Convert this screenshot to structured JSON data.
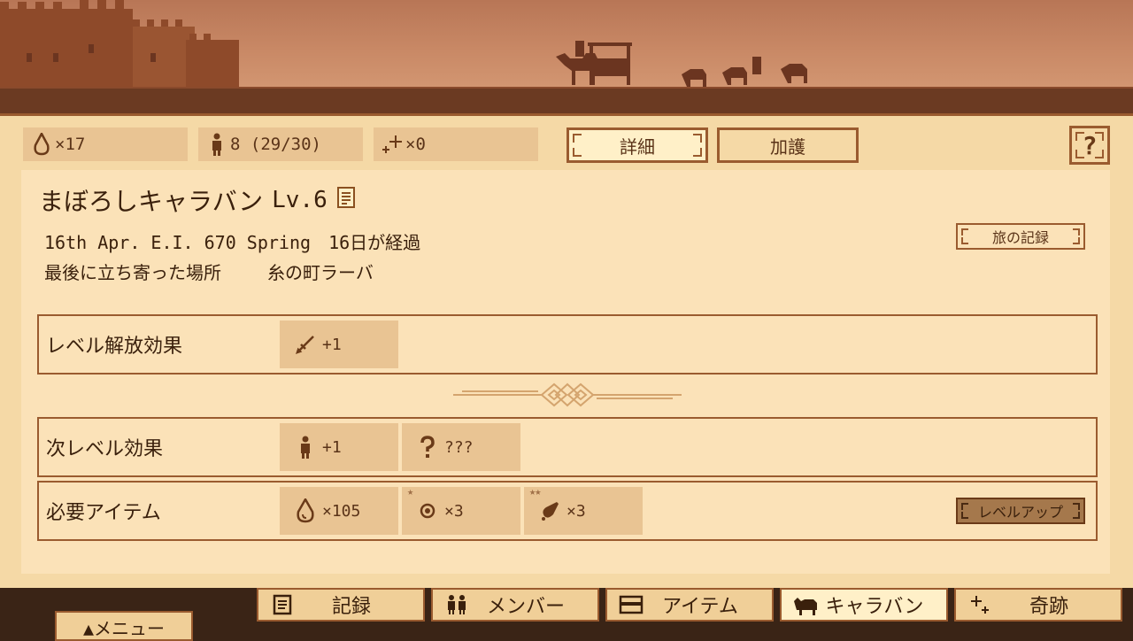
{
  "stats": {
    "water": "×17",
    "members": "8 (29/30)",
    "miracle": "×0"
  },
  "tabs": {
    "detail": "詳細",
    "blessing": "加護"
  },
  "help_label": "?",
  "caravan": {
    "name": "まぼろしキャラバン",
    "level": "Lv.6",
    "date": "16th Apr. E.I. 670 Spring",
    "elapsed": "16日が経過",
    "last_place_label": "最後に立ち寄った場所",
    "last_place": "糸の町ラーバ",
    "travel_log_button": "旅の記録"
  },
  "rows": {
    "level_effect": {
      "label": "レベル解放効果",
      "items": [
        {
          "icon": "sword-icon",
          "text": "+1"
        }
      ]
    },
    "next_effect": {
      "label": "次レベル効果",
      "items": [
        {
          "icon": "person-icon",
          "text": "+1"
        },
        {
          "icon": "question-icon",
          "text": "???"
        }
      ]
    },
    "required": {
      "label": "必要アイテム",
      "items": [
        {
          "icon": "water-drop-icon",
          "text": "×105",
          "stars": ""
        },
        {
          "icon": "coin-icon",
          "text": "×3",
          "stars": "★"
        },
        {
          "icon": "bell-icon",
          "text": "×3",
          "stars": "★★"
        }
      ],
      "button": "レベルアップ"
    }
  },
  "nav": {
    "items": [
      {
        "label": "記録",
        "icon": "document-icon"
      },
      {
        "label": "メンバー",
        "icon": "people-icon"
      },
      {
        "label": "アイテム",
        "icon": "chest-icon"
      },
      {
        "label": "キャラバン",
        "icon": "camel-icon"
      },
      {
        "label": "奇跡",
        "icon": "sparkle-icon"
      }
    ],
    "active": "キャラバン",
    "menu": "▲メニュー"
  },
  "colors": {
    "panel": "#f5d9a6",
    "inner": "#fbe2b8",
    "accent": "#9a5b2f",
    "cell": "#e9c493"
  }
}
